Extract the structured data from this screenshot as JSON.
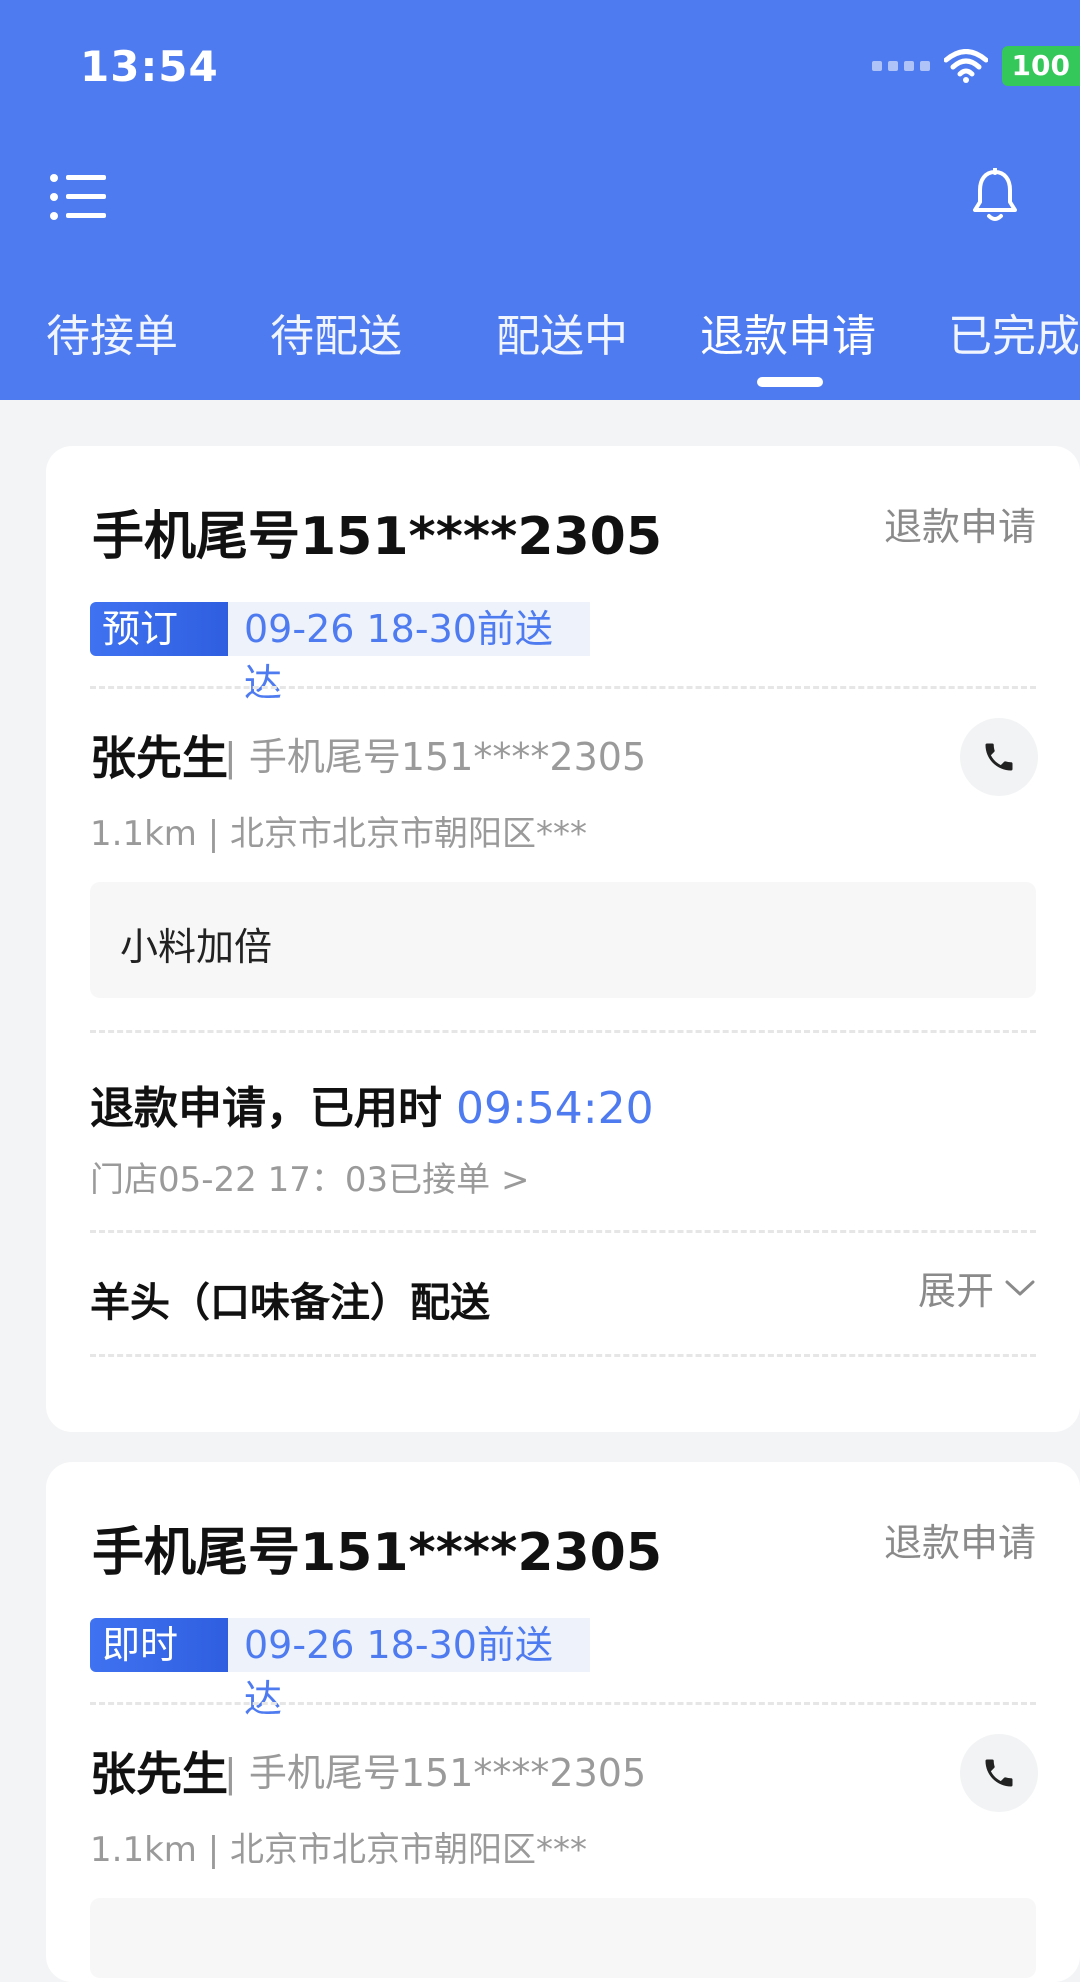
{
  "status_bar": {
    "time": "13:54",
    "battery": "100"
  },
  "tabs": [
    "待接单",
    "待配送",
    "配送中",
    "退款申请",
    "已完成"
  ],
  "orders": [
    {
      "title": "手机尾号151****2305",
      "status": "退款申请",
      "badge": "预订",
      "delivery_time": "09-26 18-30前送达",
      "customer_name": "张先生",
      "customer_phone": "| 手机尾号151****2305",
      "address": "1.1km | 北京市北京市朝阳区***",
      "note": "小料加倍",
      "refund_label": "退款申请，已用时",
      "refund_timer": "09:54:20",
      "store_accept": "门店05-22 17：03已接单 >",
      "items": "羊头（口味备注）配送",
      "expand": "展开"
    },
    {
      "title": "手机尾号151****2305",
      "status": "退款申请",
      "badge": "即时",
      "delivery_time": "09-26 18-30前送达",
      "customer_name": "张先生",
      "customer_phone": "| 手机尾号151****2305",
      "address": "1.1km | 北京市北京市朝阳区***"
    }
  ],
  "colors": {
    "primary": "#4f7bf0",
    "badge": "#3f72f0",
    "battery": "#34c759"
  },
  "icons": {
    "menu": "menu-icon",
    "bell": "bell-icon",
    "phone": "phone-icon",
    "chevron": "chevron-down-icon",
    "wifi": "wifi-icon"
  }
}
